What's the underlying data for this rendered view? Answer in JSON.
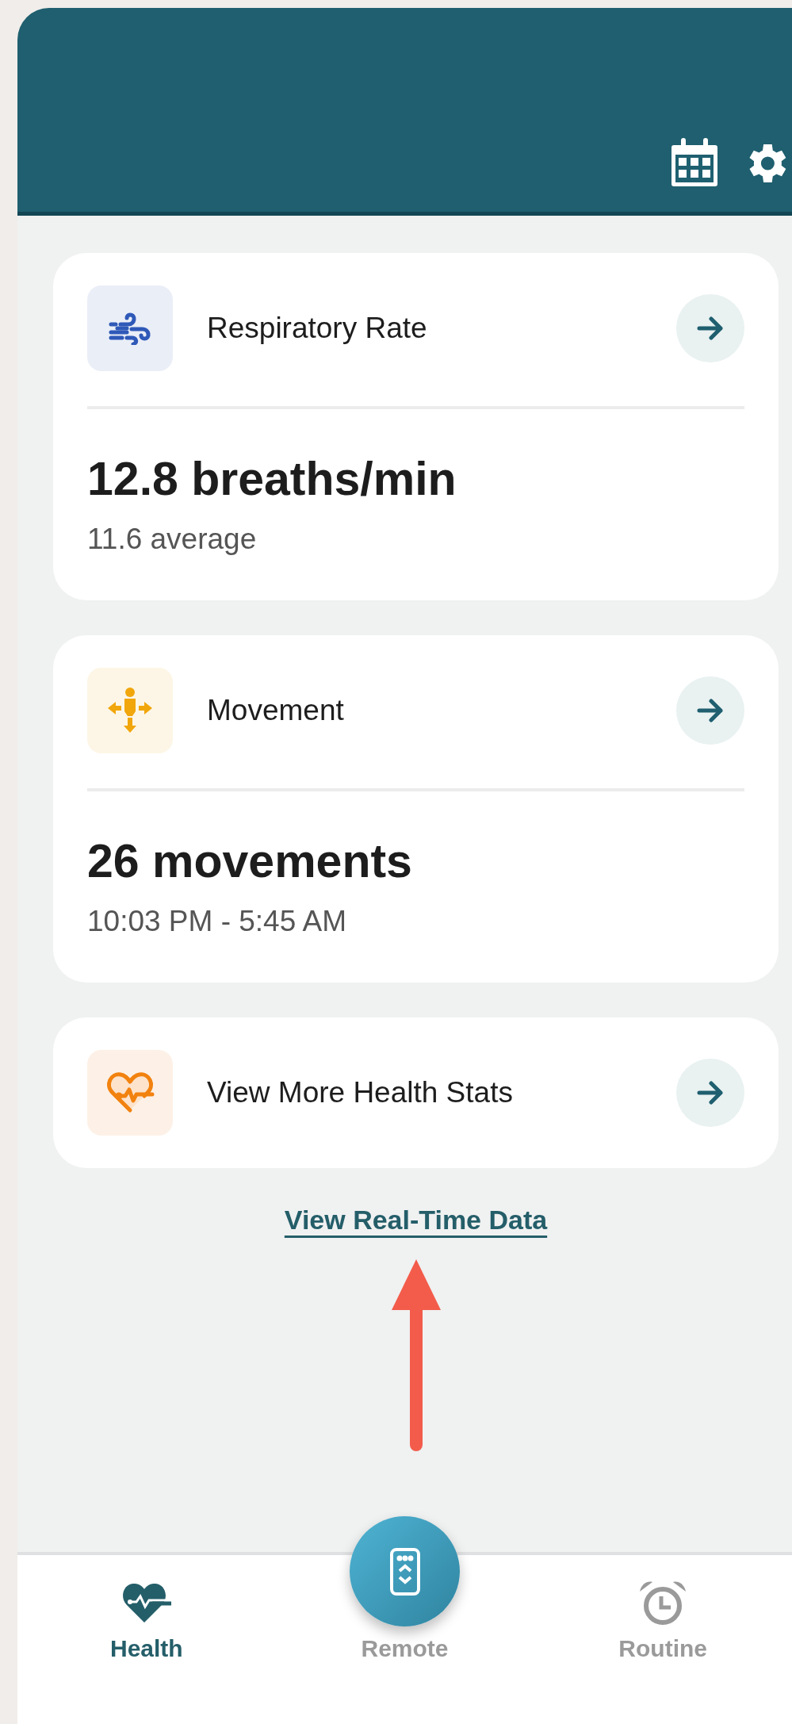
{
  "header": {
    "actions": [
      {
        "kind": "calendar"
      },
      {
        "kind": "settings"
      }
    ]
  },
  "cards": [
    {
      "kind": "respiratory",
      "title": "Respiratory Rate",
      "value": "12.8 breaths/min",
      "subtitle": "11.6 average"
    },
    {
      "kind": "movement",
      "title": "Movement",
      "value": "26 movements",
      "subtitle": "10:03 PM - 5:45 AM"
    },
    {
      "kind": "health",
      "title": "View More Health Stats"
    }
  ],
  "link": "View Real-Time Data",
  "nav": [
    {
      "kind": "health",
      "label": "Health",
      "selected": true
    },
    {
      "kind": "remote",
      "label": "Remote",
      "selected": false
    },
    {
      "kind": "routine",
      "label": "Routine",
      "selected": false
    }
  ]
}
